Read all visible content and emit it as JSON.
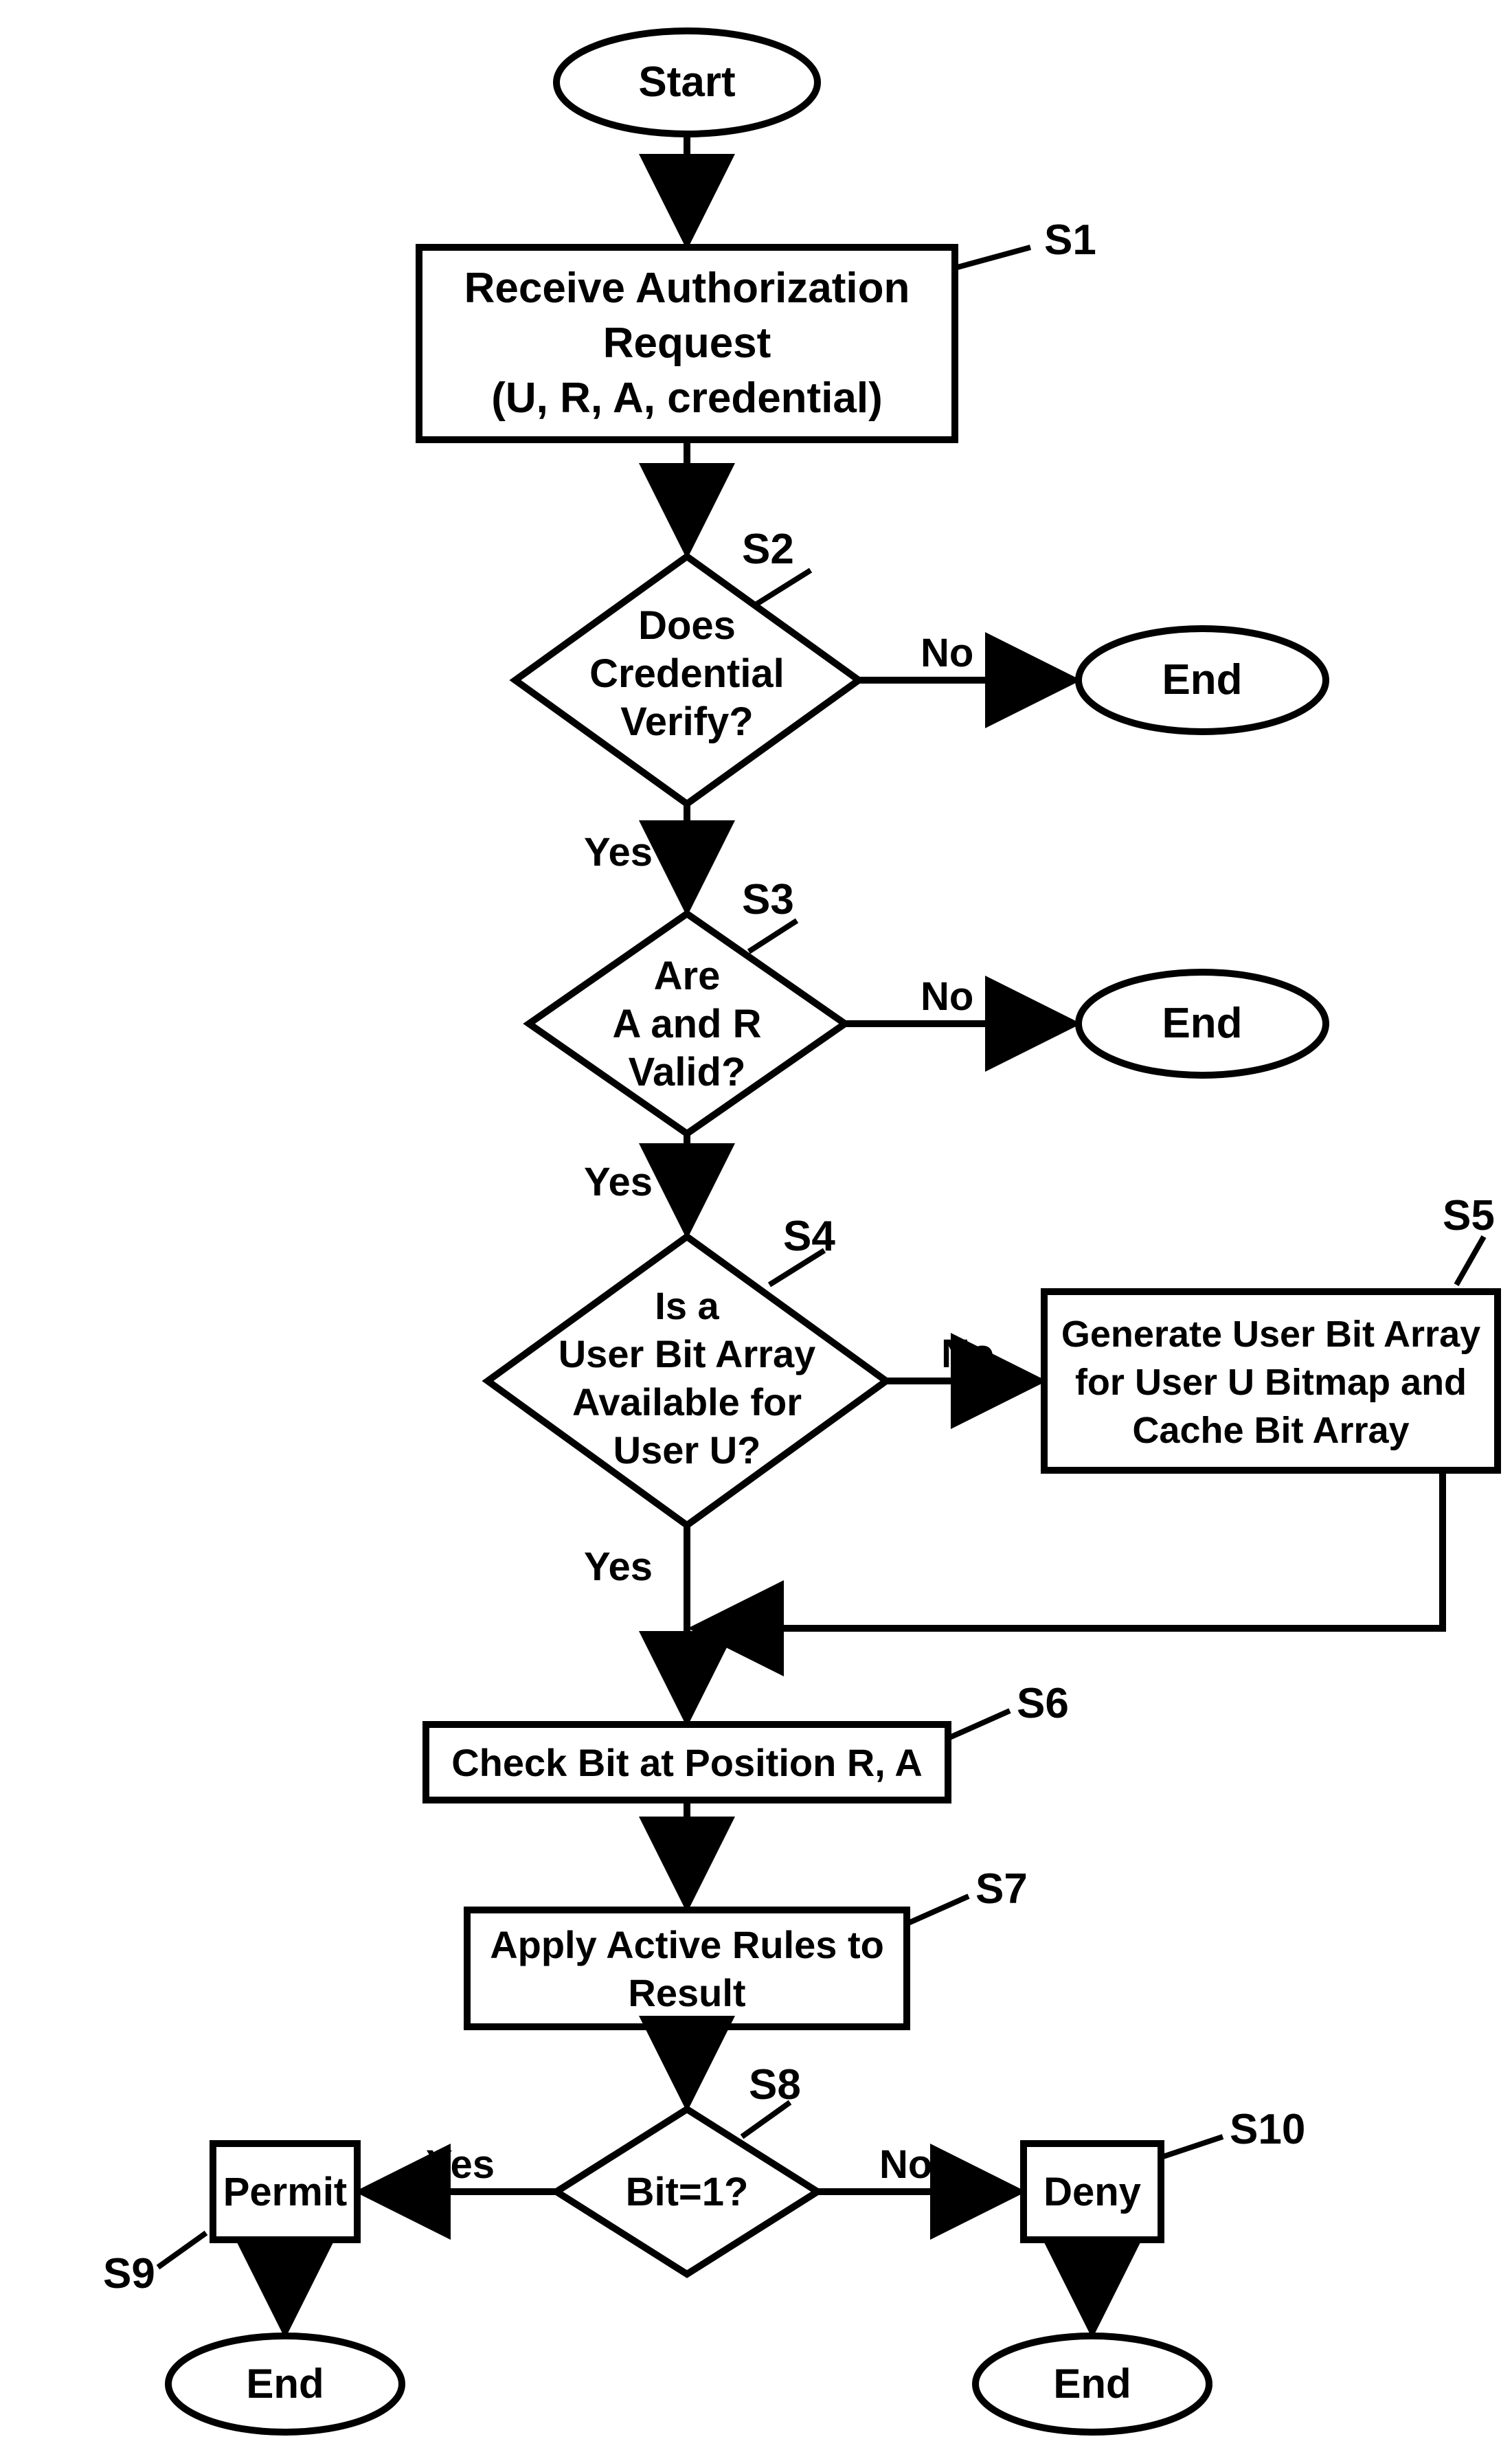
{
  "nodes": {
    "start": {
      "text": "Start"
    },
    "s1": {
      "label": "S1",
      "lines": [
        "Receive Authorization",
        "Request",
        "(U, R, A, credential)"
      ]
    },
    "s2": {
      "label": "S2",
      "lines": [
        "Does",
        "Credential",
        "Verify?"
      ]
    },
    "s3": {
      "label": "S3",
      "lines": [
        "Are",
        "A and R",
        "Valid?"
      ]
    },
    "s4": {
      "label": "S4",
      "lines": [
        "Is a",
        "User Bit Array",
        "Available for",
        "User U?"
      ]
    },
    "s5": {
      "label": "S5",
      "lines": [
        "Generate User Bit Array",
        "for User U Bitmap and",
        "Cache Bit Array"
      ]
    },
    "s6": {
      "label": "S6",
      "lines": [
        "Check Bit at Position R, A"
      ]
    },
    "s7": {
      "label": "S7",
      "lines": [
        "Apply Active Rules to",
        "Result"
      ]
    },
    "s8": {
      "label": "S8",
      "lines": [
        "Bit=1?"
      ]
    },
    "s9": {
      "label": "S9",
      "lines": [
        "Permit"
      ]
    },
    "s10": {
      "label": "S10",
      "lines": [
        "Deny"
      ]
    },
    "end": {
      "text": "End"
    }
  },
  "edges": {
    "yes": "Yes",
    "no": "No"
  }
}
